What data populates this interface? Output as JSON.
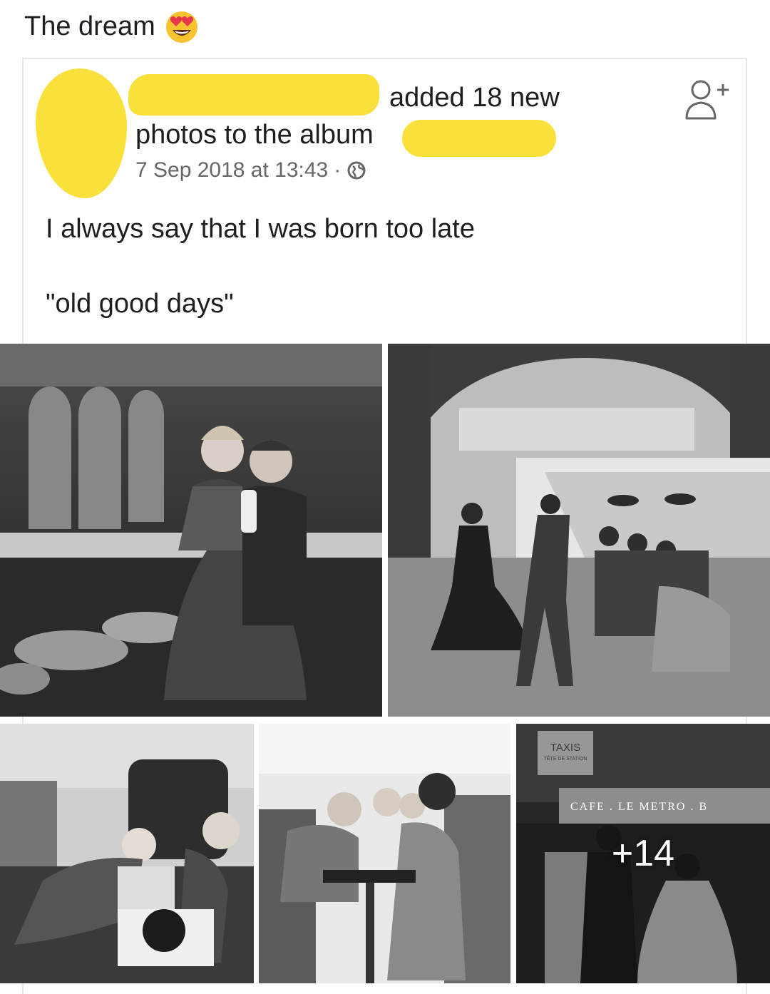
{
  "share": {
    "caption": "The dream",
    "emoji": "heart-eyes-emoji"
  },
  "post": {
    "header_line1": "added 18 new",
    "header_line2": "photos to the album",
    "timestamp": "7 Sep 2018 at 13:43",
    "separator": "·",
    "privacy_icon": "globe-icon",
    "add_friend_icon": "add-friend-icon",
    "text_line1": "I always say that I was born too late",
    "text_line2": "\"old good days\""
  },
  "photos": {
    "overlay_count": "+14",
    "storefront_sign_top": "TAXIS",
    "storefront_sign_sub": "TÊTE DE STATION",
    "storefront_awning": "CAFE . LE METRO . B"
  },
  "colors": {
    "redaction": "#f9e03b",
    "meta_gray": "#65676b",
    "card_border": "#e4e6eb"
  }
}
